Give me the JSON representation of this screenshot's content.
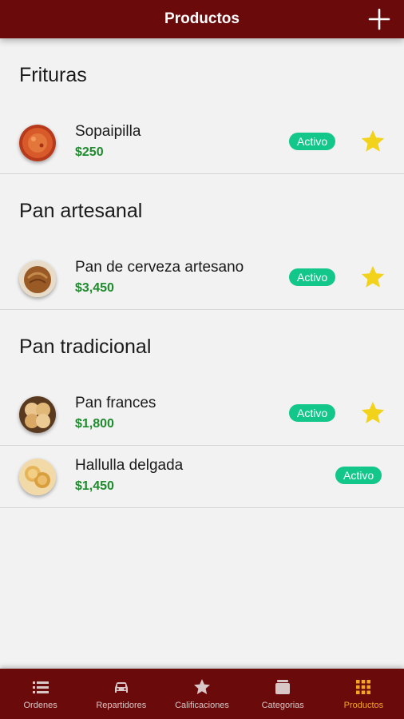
{
  "header": {
    "title": "Productos",
    "add_icon": "plus-icon"
  },
  "sections": [
    {
      "title": "Frituras",
      "items": [
        {
          "name": "Sopaipilla",
          "price": "$250",
          "status": "Activo",
          "featured": true,
          "image": "sopaipilla"
        }
      ]
    },
    {
      "title": "Pan artesanal",
      "items": [
        {
          "name": "Pan de cerveza artesano",
          "price": "$3,450",
          "status": "Activo",
          "featured": true,
          "image": "pan-cerveza"
        }
      ]
    },
    {
      "title": "Pan tradicional",
      "items": [
        {
          "name": "Pan frances",
          "price": "$1,800",
          "status": "Activo",
          "featured": true,
          "image": "pan-frances"
        },
        {
          "name": "Hallulla delgada",
          "price": "$1,450",
          "status": "Activo",
          "featured": false,
          "image": "hallulla"
        }
      ]
    }
  ],
  "bottom_nav": [
    {
      "label": "Ordenes",
      "icon": "list-icon",
      "active": false
    },
    {
      "label": "Repartidores",
      "icon": "car-icon",
      "active": false
    },
    {
      "label": "Calificaciones",
      "icon": "star-icon",
      "active": false
    },
    {
      "label": "Categorias",
      "icon": "box-icon",
      "active": false
    },
    {
      "label": "Productos",
      "icon": "grid-icon",
      "active": true
    }
  ],
  "colors": {
    "primary": "#6b0a0a",
    "badge": "#13c78b",
    "price": "#1f8a2e",
    "star": "#f2d21a",
    "active_tab": "#f5a524"
  }
}
